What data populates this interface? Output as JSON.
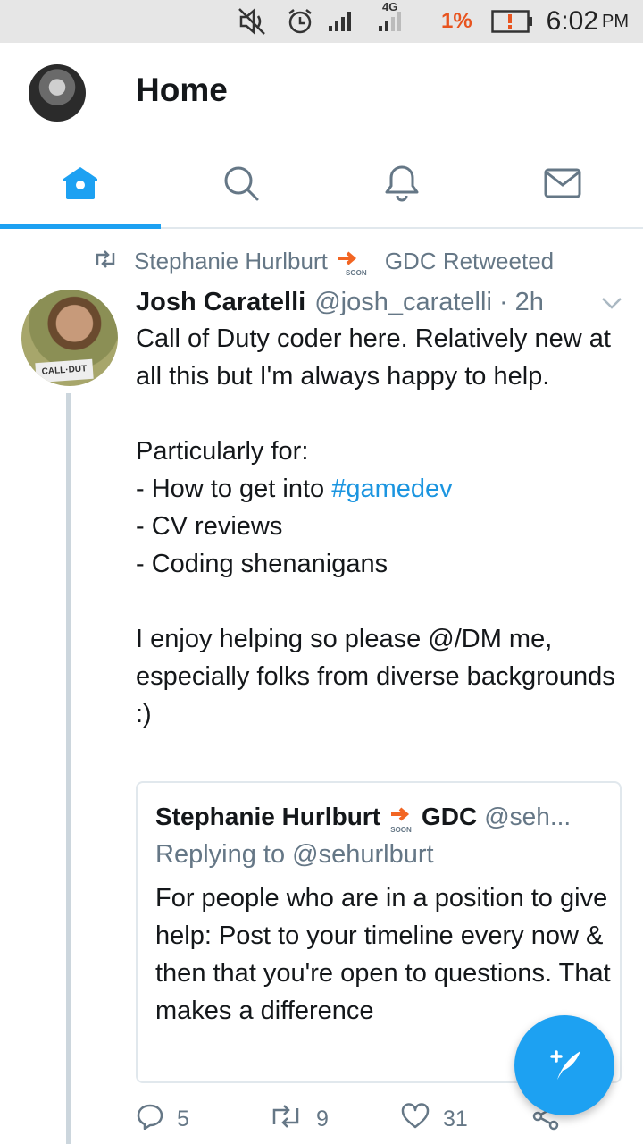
{
  "status_bar": {
    "network_type": "4G",
    "battery_percent": "1%",
    "time": "6:02",
    "ampm": "PM"
  },
  "header": {
    "title": "Home"
  },
  "tabs": [
    {
      "name": "home",
      "icon": "home-icon",
      "active": true
    },
    {
      "name": "search",
      "icon": "search-icon",
      "active": false
    },
    {
      "name": "notifications",
      "icon": "bell-icon",
      "active": false
    },
    {
      "name": "messages",
      "icon": "mail-icon",
      "active": false
    }
  ],
  "tweet": {
    "retweeted_by_name": "Stephanie Hurlburt",
    "retweeted_by_suffix": "GDC Retweeted",
    "soon_label": "SOON",
    "author_name": "Josh Caratelli",
    "author_handle": "@josh_caratelli · 2h",
    "avatar_shirt_text": "CALL·DUT",
    "text": {
      "line1": "Call of Duty coder here. Relatively new at all this but I'm always happy to help.",
      "line2": "Particularly for:",
      "line3_prefix": "- How to get into ",
      "hashtag": "#gamedev",
      "line4": "- CV reviews",
      "line5": "- Coding shenanigans",
      "line6": "I enjoy helping so please @/DM me, especially folks from diverse backgrounds :)"
    },
    "quote": {
      "name": "Stephanie Hurlburt",
      "name_suffix": "GDC",
      "handle": "@seh...",
      "soon_label": "SOON",
      "replying_to": "Replying to @sehurlburt",
      "text": "For people who are in a position to give help: Post to your timeline every now & then that you're open to questions. That makes a difference"
    },
    "actions": {
      "replies": "5",
      "retweets": "9",
      "likes": "31"
    }
  },
  "colors": {
    "accent": "#1da1f2",
    "hashtag": "#1b95e0",
    "secondary_text": "#657786",
    "battery_low": "#e8541f",
    "soon_arrow": "#f26522"
  }
}
